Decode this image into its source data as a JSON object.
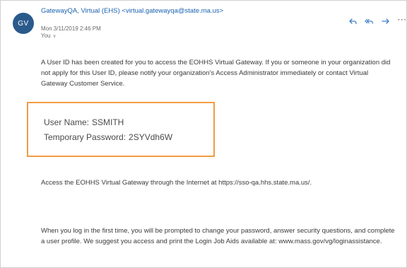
{
  "email": {
    "avatar_initials": "GV",
    "sender_line": "GatewayQA, Virtual (EHS) <virtual.gatewayqa@state.ma.us>",
    "date": "Mon 3/11/2019 2:46 PM",
    "recipient": "You",
    "actions": {
      "reply_icon": "reply-icon",
      "reply_all_icon": "reply-all-icon",
      "forward_icon": "forward-icon",
      "more_icon": "more-icon"
    },
    "body": {
      "paragraph1": "A User ID has been created for you to access the EOHHS Virtual Gateway. If you or someone in your organization did not apply for this User ID, please notify your organization's Access Administrator immediately or contact Virtual Gateway Customer Service.",
      "credentials": {
        "username_label": "User Name:",
        "username_value": "SSMITH",
        "password_label": "Temporary Password:",
        "password_value": "2SYVdh6W"
      },
      "paragraph2": "Access the EOHHS Virtual Gateway through the Internet at https://sso-qa.hhs.state.ma.us/.",
      "paragraph3": "When you log in the first time, you will be prompted to change your password, answer security questions, and complete a user profile. We suggest you access and print the Login Job Aids available at: www.mass.gov/vg/loginassistance."
    },
    "colors": {
      "sender": "#1a62b0",
      "avatar": "#2a5a8c",
      "highlight_border": "#f29b44"
    }
  }
}
